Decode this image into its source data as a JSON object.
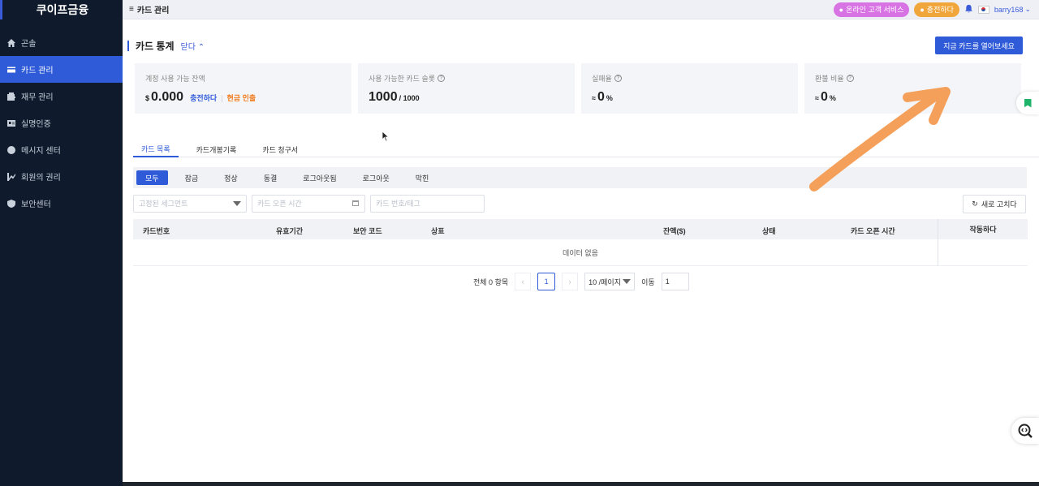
{
  "app": {
    "brand": "쿠이프금융"
  },
  "sidebar": {
    "items": [
      {
        "label": "곤솔",
        "icon": "home-icon"
      },
      {
        "label": "카드 관리",
        "icon": "card-icon",
        "active": true
      },
      {
        "label": "재무 관리",
        "icon": "wallet-icon"
      },
      {
        "label": "실명인증",
        "icon": "id-card-icon"
      },
      {
        "label": "메시지 센터",
        "icon": "chat-icon"
      },
      {
        "label": "회원의 권리",
        "icon": "member-icon"
      },
      {
        "label": "보안센터",
        "icon": "shield-icon"
      }
    ]
  },
  "topbar": {
    "title": "카드 관리",
    "service_label": "온라인 고객 서비스",
    "charge_label": "충전하다",
    "username": "barry168"
  },
  "stats_section": {
    "title": "카드 통계",
    "collapse_label": "닫다",
    "open_card_button": "지금 카드를 열어보세요",
    "cards": [
      {
        "label": "계정 사용 가능 잔액",
        "prefix": "$",
        "value": "0.000",
        "link1": "충전하다",
        "separator": "|",
        "link2": "현금 인출"
      },
      {
        "label": "사용 가능한 카드 슬롯",
        "value": "1000",
        "suffix": "/ 1000"
      },
      {
        "label": "실패율",
        "prefix": "≈",
        "value": "0",
        "suffix": "%"
      },
      {
        "label": "환불 비율",
        "prefix": "≈",
        "value": "0",
        "suffix": "%"
      }
    ]
  },
  "tabs": [
    {
      "label": "카드 목록",
      "active": true
    },
    {
      "label": "카드개봉기록"
    },
    {
      "label": "카드 청구서"
    }
  ],
  "filters": [
    {
      "label": "모두",
      "active": true
    },
    {
      "label": "잠금"
    },
    {
      "label": "정상"
    },
    {
      "label": "동결"
    },
    {
      "label": "로그아웃됨"
    },
    {
      "label": "로그아웃"
    },
    {
      "label": "막힌"
    }
  ],
  "search": {
    "segment_placeholder": "고정된 세그먼트",
    "date_placeholder": "카드 오픈 시간",
    "card_placeholder": "카드 번호/태그",
    "refresh_label": "새로 고치다"
  },
  "table": {
    "columns": [
      "카드번호",
      "유효기간",
      "보안 코드",
      "상표",
      "잔액($)",
      "상태",
      "카드 오픈 시간",
      "작동하다"
    ],
    "empty_text": "데이터 없음"
  },
  "pagination": {
    "total_label": "전체 0 항목",
    "current_page": "1",
    "page_size": "10 /페이지",
    "jump_label": "이동",
    "jump_value": "1"
  },
  "colors": {
    "accent": "#2f5bd8",
    "sidebar": "#0f1b2d",
    "annotation_arrow": "#f5a05a"
  }
}
